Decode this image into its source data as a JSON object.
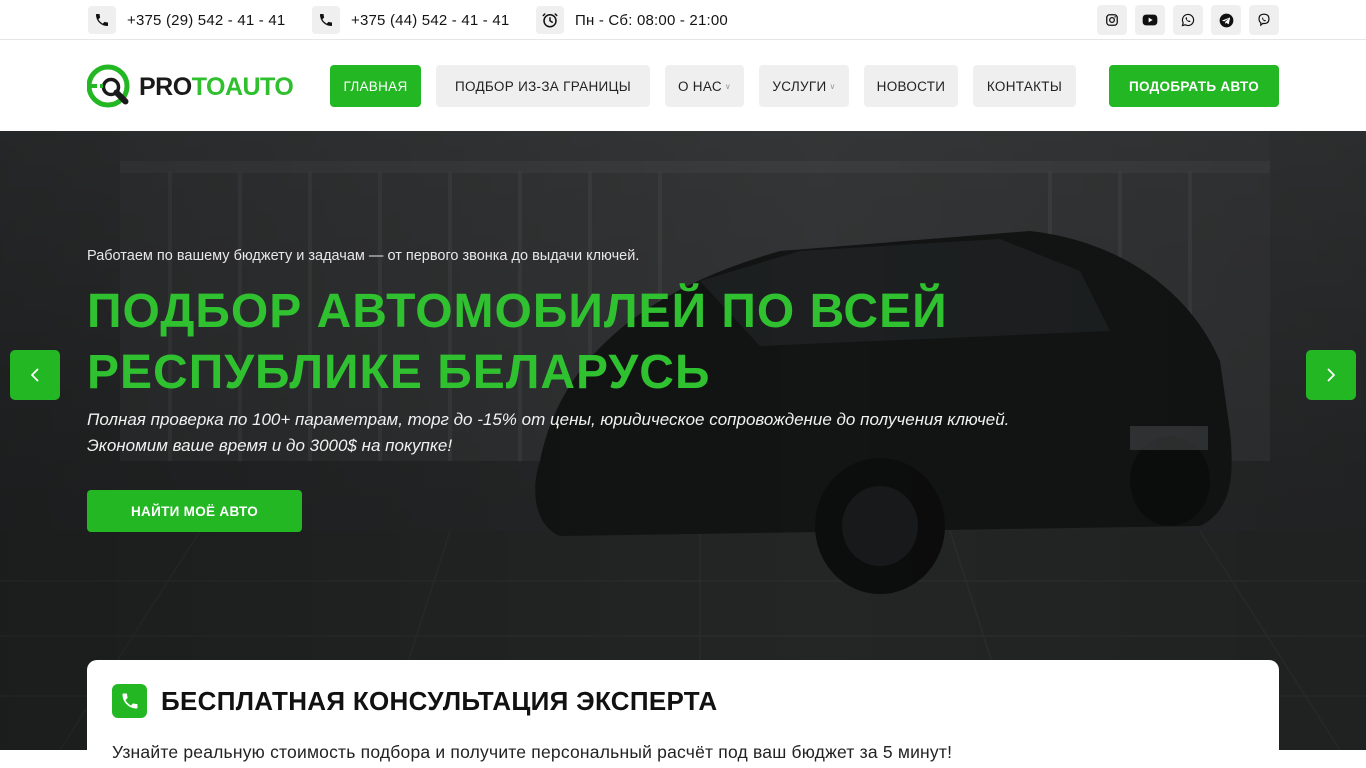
{
  "topbar": {
    "phone1": "+375 (29) 542 - 41 - 41",
    "phone2": "+375 (44) 542 - 41 - 41",
    "hours": "Пн - Сб: 08:00 - 21:00",
    "icons": [
      "phone-icon",
      "phone-icon",
      "clock-icon"
    ],
    "social": [
      "instagram-icon",
      "youtube-icon",
      "whatsapp-icon",
      "telegram-icon",
      "viber-icon"
    ]
  },
  "header": {
    "logo": {
      "part1": "PRO",
      "part2": "TO",
      "part3": "AUTO"
    },
    "nav": [
      {
        "label": "ГЛАВНАЯ",
        "active": true,
        "has_dropdown": false
      },
      {
        "label": "ПОДБОР ИЗ-ЗА ГРАНИЦЫ",
        "active": false,
        "has_dropdown": false
      },
      {
        "label": "О НАС",
        "active": false,
        "has_dropdown": true
      },
      {
        "label": "УСЛУГИ",
        "active": false,
        "has_dropdown": true
      },
      {
        "label": "НОВОСТИ",
        "active": false,
        "has_dropdown": false
      },
      {
        "label": "КОНТАКТЫ",
        "active": false,
        "has_dropdown": false
      }
    ],
    "cta_label": "ПОДОБРАТЬ АВТО"
  },
  "hero": {
    "subtitle": "Работаем по вашему бюджету и задачам — от первого звонка до выдачи ключей.",
    "title": "ПОДБОР АВТОМОБИЛЕЙ ПО ВСЕЙ РЕСПУБЛИКЕ БЕЛАРУСЬ",
    "description_line1": "Полная проверка по 100+ параметрам, торг до -15% от цены, юридическое сопровождение до получения ключей.",
    "description_line2": "Экономим ваше время и до 3000$ на покупке!",
    "button_label": "НАЙТИ МОЁ АВТО",
    "prev_icon": "chevron-left-icon",
    "next_icon": "chevron-right-icon"
  },
  "consultation": {
    "icon": "phone-icon",
    "title": "БЕСПЛАТНАЯ КОНСУЛЬТАЦИЯ ЭКСПЕРТА",
    "text": "Узнайте реальную стоимость подбора и получите персональный расчёт под ваш бюджет за 5 минут!"
  },
  "colors": {
    "accent": "#24b724",
    "accent_text": "#2fc12f",
    "dark": "#141414",
    "pill_bg": "#efefef"
  }
}
